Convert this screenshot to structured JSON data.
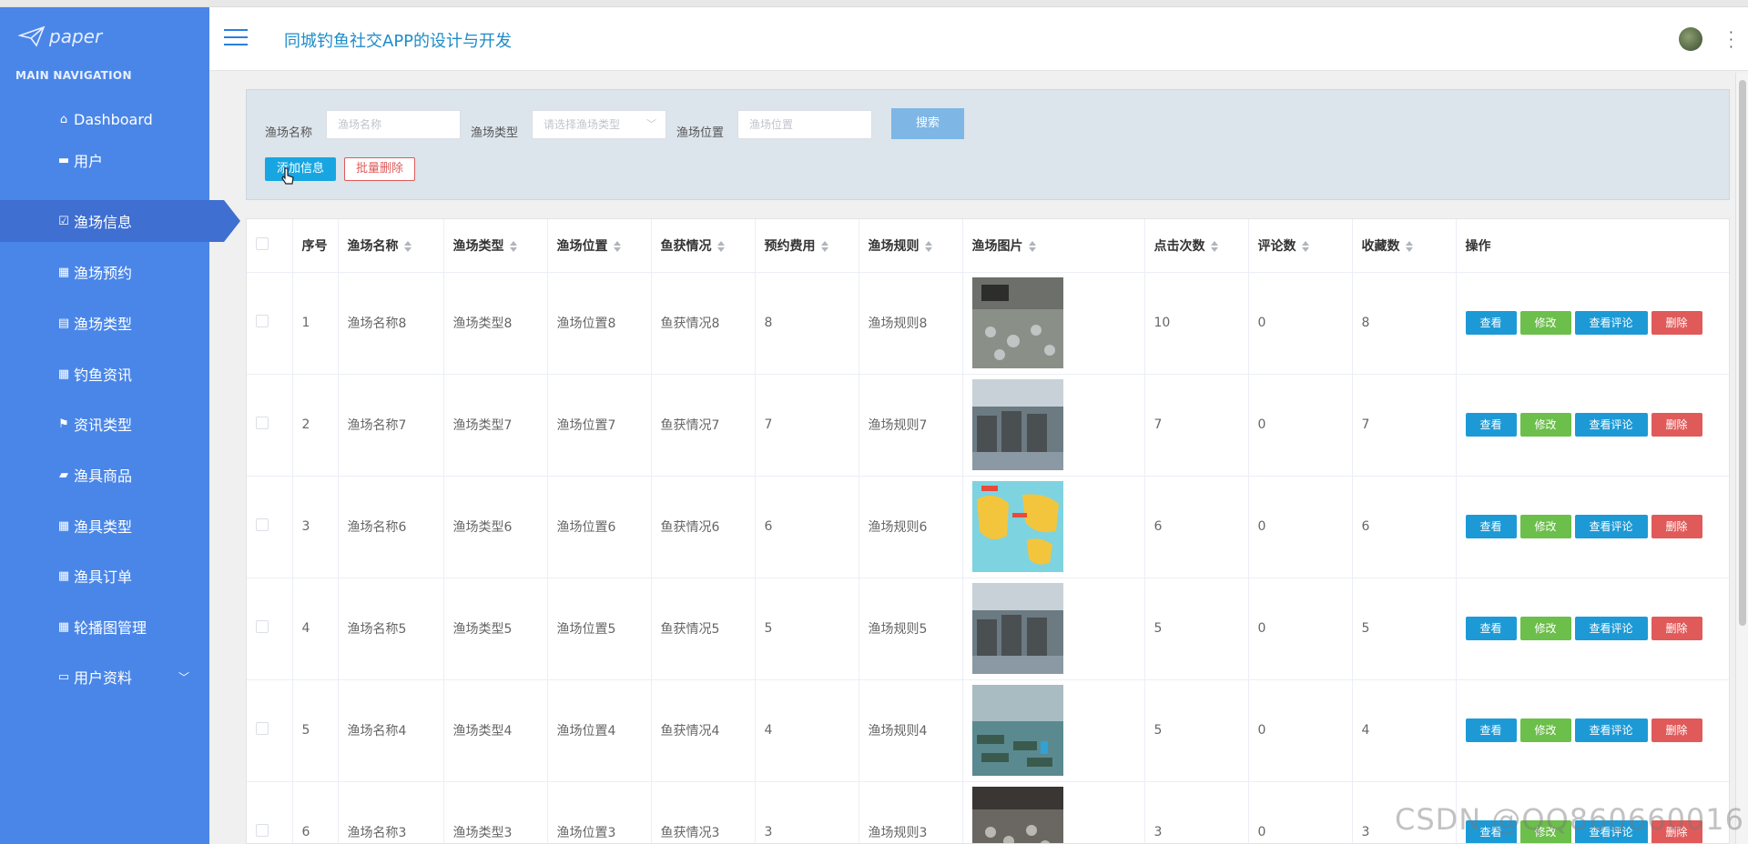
{
  "brand": {
    "name": "paper"
  },
  "nav": {
    "caption": "MAIN NAVIGATION",
    "items": [
      {
        "label": "Dashboard",
        "icon": "home-icon"
      },
      {
        "label": "用户",
        "icon": "briefcase-icon"
      },
      {
        "label": "渔场信息",
        "icon": "check-square-icon"
      },
      {
        "label": "渔场预约",
        "icon": "grid-icon"
      },
      {
        "label": "渔场类型",
        "icon": "file-icon"
      },
      {
        "label": "钓鱼资讯",
        "icon": "grid-icon"
      },
      {
        "label": "资讯类型",
        "icon": "flag-icon"
      },
      {
        "label": "渔具商品",
        "icon": "ticket-icon"
      },
      {
        "label": "渔具类型",
        "icon": "grid-icon"
      },
      {
        "label": "渔具订单",
        "icon": "grid-icon"
      },
      {
        "label": "轮播图管理",
        "icon": "grid-icon"
      },
      {
        "label": "用户资料",
        "icon": "card-icon"
      }
    ]
  },
  "header": {
    "title": "同城钓鱼社交APP的设计与开发"
  },
  "search": {
    "name_label": "渔场名称",
    "name_placeholder": "渔场名称",
    "type_label": "渔场类型",
    "type_placeholder": "请选择渔场类型",
    "location_label": "渔场位置",
    "location_placeholder": "渔场位置",
    "search_button": "搜索",
    "add_button": "添加信息",
    "batch_delete_button": "批量删除"
  },
  "table": {
    "headers": [
      "序号",
      "渔场名称",
      "渔场类型",
      "渔场位置",
      "鱼获情况",
      "预约费用",
      "渔场规则",
      "渔场图片",
      "点击次数",
      "评论数",
      "收藏数",
      "操作"
    ],
    "actions": {
      "view": "查看",
      "edit": "修改",
      "comment": "查看评论",
      "delete": "删除"
    },
    "rows": [
      {
        "index": "1",
        "name": "渔场名称8",
        "type": "渔场类型8",
        "location": "渔场位置8",
        "catch": "鱼获情况8",
        "fee": "8",
        "rules": "渔场规则8",
        "clicks": "10",
        "comments": "0",
        "favorites": "8"
      },
      {
        "index": "2",
        "name": "渔场名称7",
        "type": "渔场类型7",
        "location": "渔场位置7",
        "catch": "鱼获情况7",
        "fee": "7",
        "rules": "渔场规则7",
        "clicks": "7",
        "comments": "0",
        "favorites": "7"
      },
      {
        "index": "3",
        "name": "渔场名称6",
        "type": "渔场类型6",
        "location": "渔场位置6",
        "catch": "鱼获情况6",
        "fee": "6",
        "rules": "渔场规则6",
        "clicks": "6",
        "comments": "0",
        "favorites": "6"
      },
      {
        "index": "4",
        "name": "渔场名称5",
        "type": "渔场类型5",
        "location": "渔场位置5",
        "catch": "鱼获情况5",
        "fee": "5",
        "rules": "渔场规则5",
        "clicks": "5",
        "comments": "0",
        "favorites": "5"
      },
      {
        "index": "5",
        "name": "渔场名称4",
        "type": "渔场类型4",
        "location": "渔场位置4",
        "catch": "鱼获情况4",
        "fee": "4",
        "rules": "渔场规则4",
        "clicks": "5",
        "comments": "0",
        "favorites": "4"
      },
      {
        "index": "6",
        "name": "渔场名称3",
        "type": "渔场类型3",
        "location": "渔场位置3",
        "catch": "鱼获情况3",
        "fee": "3",
        "rules": "渔场规则3",
        "clicks": "3",
        "comments": "0",
        "favorites": "3"
      }
    ]
  },
  "watermark": "CSDN @QQ860660016",
  "colors": {
    "sidebar": "#4a86e8",
    "accent": "#1d9ad6",
    "edit": "#6cbf4a",
    "danger": "#e05a5a"
  }
}
